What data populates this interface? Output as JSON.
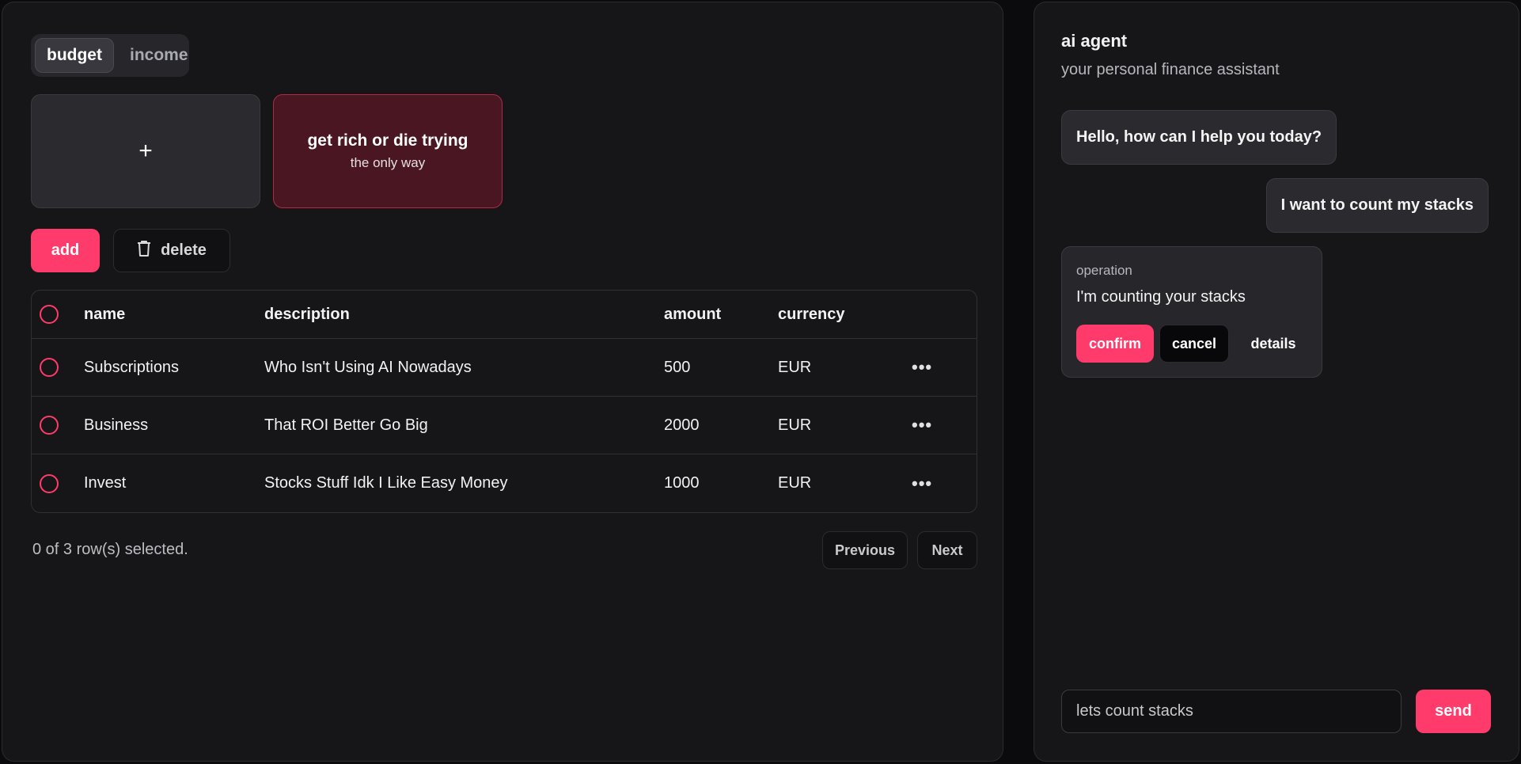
{
  "tabs": [
    {
      "label": "budget",
      "active": true
    },
    {
      "label": "income",
      "active": false
    }
  ],
  "cards": {
    "add_symbol": "+",
    "budget_title": "get rich or die trying",
    "budget_subtitle": "the only way"
  },
  "actions": {
    "add_label": "add",
    "delete_label": "delete"
  },
  "table": {
    "columns": [
      "name",
      "description",
      "amount",
      "currency"
    ],
    "rows": [
      {
        "name": "Subscriptions",
        "description": "Who Isn't Using AI Nowadays",
        "amount": "500",
        "currency": "EUR"
      },
      {
        "name": "Business",
        "description": "That ROI Better Go Big",
        "amount": "2000",
        "currency": "EUR"
      },
      {
        "name": "Invest",
        "description": "Stocks Stuff Idk I Like Easy Money",
        "amount": "1000",
        "currency": "EUR"
      }
    ],
    "more_glyph": "•••"
  },
  "footer": {
    "selected_text": "0 of 3 row(s) selected.",
    "previous_label": "Previous",
    "next_label": "Next"
  },
  "agent": {
    "title": "ai agent",
    "subtitle": "your personal finance assistant",
    "messages": [
      {
        "role": "assistant",
        "text": "Hello, how can I help you today?"
      },
      {
        "role": "user",
        "text": "I want to count my stacks"
      }
    ],
    "operation": {
      "label": "operation",
      "text": "I'm counting your stacks",
      "confirm_label": "confirm",
      "cancel_label": "cancel",
      "details_label": "details"
    },
    "input_value": "lets count stacks",
    "send_label": "send"
  },
  "colors": {
    "accent": "#ff3b6b",
    "background": "#161619",
    "budget_card": "#4a1622"
  }
}
